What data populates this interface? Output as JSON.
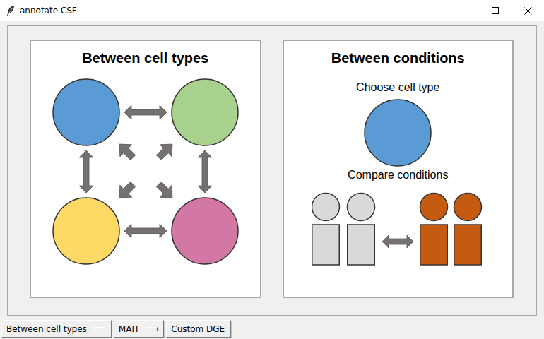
{
  "window": {
    "title": "annotate CSF"
  },
  "panels": [
    {
      "title": "Between cell types",
      "kind": "cell-types",
      "cells": [
        {
          "color": "#5b9bd5"
        },
        {
          "color": "#a9d18e"
        },
        {
          "color": "#ffd966"
        },
        {
          "color": "#d377a4"
        }
      ]
    },
    {
      "title": "Between conditions",
      "kind": "conditions",
      "steps": [
        "Choose cell type",
        "Compare conditions"
      ],
      "cell_color": "#5b9bd5",
      "groups": [
        {
          "color": "#d9d9d9"
        },
        {
          "color": "#c55a11"
        }
      ]
    }
  ],
  "toolbar": [
    {
      "label": "Between cell types",
      "kind": "menu"
    },
    {
      "label": "MAIT",
      "kind": "menu"
    },
    {
      "label": "Custom DGE",
      "kind": "button"
    }
  ]
}
